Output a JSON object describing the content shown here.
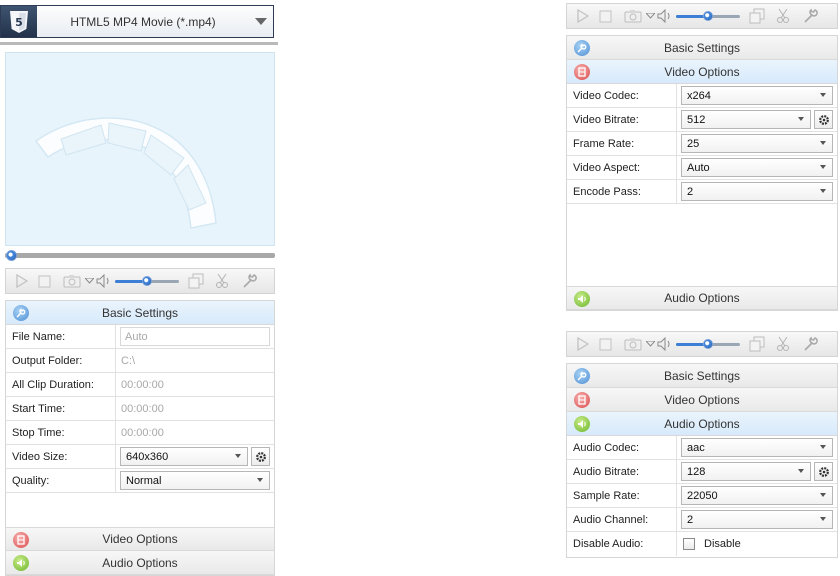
{
  "format": {
    "label": "HTML5 MP4 Movie (*.mp4)",
    "icon": "html5-icon",
    "accent": "#2a3a55"
  },
  "panel_titles": {
    "basic": "Basic Settings",
    "video": "Video Options",
    "audio": "Audio Options"
  },
  "basic": {
    "file_name": {
      "label": "File Name:",
      "placeholder": "Auto"
    },
    "output_folder": {
      "label": "Output Folder:",
      "value": "C:\\"
    },
    "all_clip_duration": {
      "label": "All Clip Duration:",
      "value": "00:00:00"
    },
    "start_time": {
      "label": "Start Time:",
      "value": "00:00:00"
    },
    "stop_time": {
      "label": "Stop Time:",
      "value": "00:00:00"
    },
    "video_size": {
      "label": "Video Size:",
      "value": "640x360"
    },
    "quality": {
      "label": "Quality:",
      "value": "Normal"
    }
  },
  "video": {
    "codec": {
      "label": "Video Codec:",
      "value": "x264"
    },
    "bitrate": {
      "label": "Video Bitrate:",
      "value": "512"
    },
    "frame_rate": {
      "label": "Frame Rate:",
      "value": "25"
    },
    "aspect": {
      "label": "Video Aspect:",
      "value": "Auto"
    },
    "encode_pass": {
      "label": "Encode Pass:",
      "value": "2"
    }
  },
  "audio": {
    "codec": {
      "label": "Audio Codec:",
      "value": "aac"
    },
    "bitrate": {
      "label": "Audio Bitrate:",
      "value": "128"
    },
    "sample_rate": {
      "label": "Sample Rate:",
      "value": "22050"
    },
    "channel": {
      "label": "Audio Channel:",
      "value": "2"
    },
    "disable": {
      "label": "Disable Audio:",
      "checkbox_label": "Disable",
      "checked": false
    }
  },
  "player": {
    "seek_position": 0.0,
    "volume": 0.5
  },
  "icons": [
    "play-icon",
    "stop-icon",
    "snapshot-icon",
    "volume-icon",
    "copy-icon",
    "scissors-icon",
    "wrench-icon",
    "gear-icon",
    "film-icon",
    "speaker-icon"
  ],
  "colors": {
    "header_active": "#d7eafb",
    "preview_bg": "#e7f4fb",
    "slider": "#3d7fd6"
  }
}
